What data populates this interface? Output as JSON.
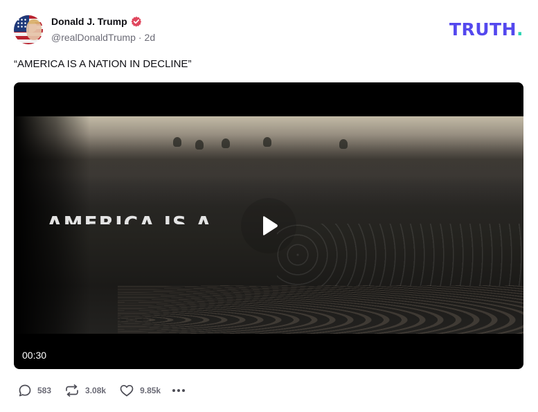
{
  "post": {
    "author_name": "Donald J. Trump",
    "handle": "@realDonaldTrump",
    "separator": "·",
    "time_ago": "2d",
    "text": "“AMERICA IS A NATION IN DECLINE”"
  },
  "brand": {
    "name": "TRUTH",
    "dot": ".",
    "color": "#5448ee",
    "dot_color": "#2bd4b3"
  },
  "video": {
    "overlay_text": "AMERICA IS A",
    "duration": "00:30",
    "play_icon": "play-icon"
  },
  "actions": {
    "replies": "583",
    "retruths": "3.08k",
    "likes": "9.85k",
    "icons": [
      "reply-icon",
      "retruth-icon",
      "like-icon",
      "more-icon"
    ]
  },
  "colors": {
    "verified_badge": "#e0475e",
    "muted_text": "#6b6b76"
  }
}
